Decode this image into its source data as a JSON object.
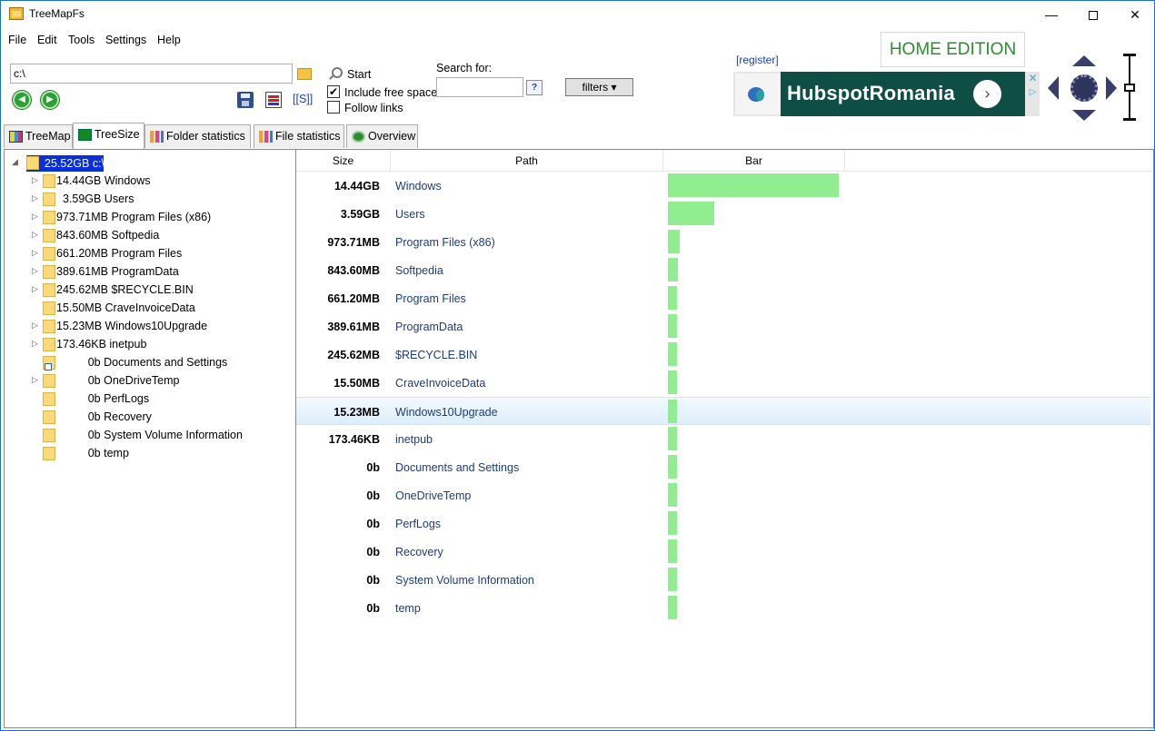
{
  "window": {
    "title": "TreeMapFs",
    "minimize": "—",
    "close": "✕"
  },
  "menu": [
    "File",
    "Edit",
    "Tools",
    "Settings",
    "Help"
  ],
  "toolbar": {
    "path_value": "c:\\",
    "start_label": "Start",
    "include_free_space_label": "Include free space",
    "include_free_space_checked": true,
    "follow_links_label": "Follow links",
    "follow_links_checked": false,
    "search_label": "Search for:",
    "search_value": "",
    "help_label": "?",
    "filters_label": "filters ▾",
    "s_link": "[[S]]"
  },
  "promo": {
    "register_label": "[register]",
    "edition_label": "HOME EDITION",
    "ad_title": "HubspotRomania",
    "ad_arrow": "›",
    "ad_close": "✕",
    "ad_choice": "▷"
  },
  "tabs": [
    "TreeMap",
    "TreeSize",
    "Folder statistics",
    "File statistics",
    "Overview"
  ],
  "active_tab": "TreeSize",
  "tree": {
    "root_label": "25.52GB c:\\",
    "items": [
      {
        "label": "14.44GB Windows",
        "expandable": true,
        "shortcut": false
      },
      {
        "label": "  3.59GB Users",
        "expandable": true,
        "shortcut": false
      },
      {
        "label": "973.71MB Program Files (x86)",
        "expandable": true,
        "shortcut": false
      },
      {
        "label": "843.60MB Softpedia",
        "expandable": true,
        "shortcut": false
      },
      {
        "label": "661.20MB Program Files",
        "expandable": true,
        "shortcut": false
      },
      {
        "label": "389.61MB ProgramData",
        "expandable": true,
        "shortcut": false
      },
      {
        "label": "245.62MB $RECYCLE.BIN",
        "expandable": true,
        "shortcut": false
      },
      {
        "label": "15.50MB CraveInvoiceData",
        "expandable": false,
        "shortcut": false
      },
      {
        "label": "15.23MB Windows10Upgrade",
        "expandable": true,
        "shortcut": false
      },
      {
        "label": "173.46KB inetpub",
        "expandable": true,
        "shortcut": false
      },
      {
        "label": "          0b Documents and Settings",
        "expandable": false,
        "shortcut": true
      },
      {
        "label": "          0b OneDriveTemp",
        "expandable": true,
        "shortcut": false
      },
      {
        "label": "          0b PerfLogs",
        "expandable": false,
        "shortcut": false
      },
      {
        "label": "          0b Recovery",
        "expandable": false,
        "shortcut": false
      },
      {
        "label": "          0b System Volume Information",
        "expandable": false,
        "shortcut": false
      },
      {
        "label": "          0b temp",
        "expandable": false,
        "shortcut": false
      }
    ]
  },
  "grid": {
    "columns": [
      "Size",
      "Path",
      "Bar"
    ],
    "highlight_index": 8,
    "rows": [
      {
        "size": "14.44GB",
        "path": "Windows",
        "share": 1.0
      },
      {
        "size": "3.59GB",
        "path": "Users",
        "share": 0.27
      },
      {
        "size": "973.71MB",
        "path": "Program Files (x86)",
        "share": 0.07
      },
      {
        "size": "843.60MB",
        "path": "Softpedia",
        "share": 0.06
      },
      {
        "size": "661.20MB",
        "path": "Program Files",
        "share": 0.05
      },
      {
        "size": "389.61MB",
        "path": "ProgramData",
        "share": 0.05
      },
      {
        "size": "245.62MB",
        "path": "$RECYCLE.BIN",
        "share": 0.05
      },
      {
        "size": "15.50MB",
        "path": "CraveInvoiceData",
        "share": 0.05
      },
      {
        "size": "15.23MB",
        "path": "Windows10Upgrade",
        "share": 0.05
      },
      {
        "size": "173.46KB",
        "path": "inetpub",
        "share": 0.05
      },
      {
        "size": "0b",
        "path": "Documents and Settings",
        "share": 0.05
      },
      {
        "size": "0b",
        "path": "OneDriveTemp",
        "share": 0.05
      },
      {
        "size": "0b",
        "path": "PerfLogs",
        "share": 0.05
      },
      {
        "size": "0b",
        "path": "Recovery",
        "share": 0.05
      },
      {
        "size": "0b",
        "path": "System Volume Information",
        "share": 0.05
      },
      {
        "size": "0b",
        "path": "temp",
        "share": 0.05
      }
    ]
  },
  "colors": {
    "bar_fill": "#90ee90",
    "selection": "#0b2fd6",
    "path_text": "#1e3c78",
    "link": "#1a3fb0",
    "edition_text": "#2e8b2e",
    "ad_background": "#0f4e45"
  },
  "icons": {
    "app": "folder-icon",
    "browse": "folder-open-icon",
    "back": "back-arrow-icon",
    "forward": "forward-arrow-icon",
    "save": "save-icon",
    "export": "export-report-icon",
    "start": "magnifier-icon"
  }
}
